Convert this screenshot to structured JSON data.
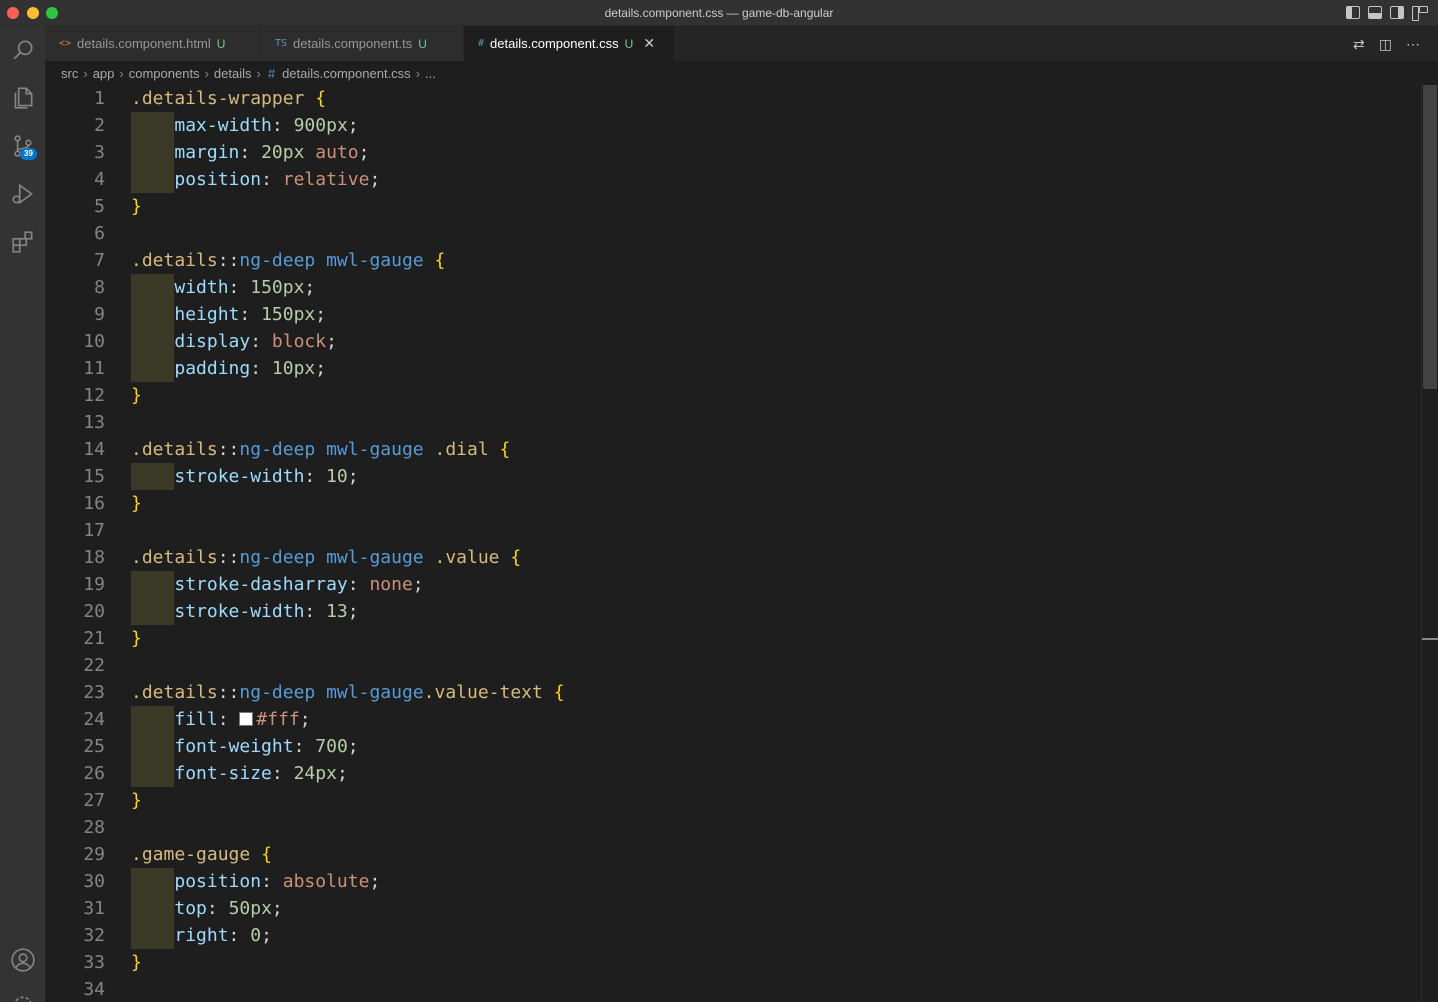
{
  "window": {
    "title": "details.component.css — game-db-angular"
  },
  "activity_bar": {
    "items": [
      {
        "name": "explorer-search",
        "icon": "search-icon"
      },
      {
        "name": "explorer",
        "icon": "files-icon"
      },
      {
        "name": "source-control",
        "icon": "source-control-icon",
        "badge": "39"
      },
      {
        "name": "run-debug",
        "icon": "run-debug-icon"
      },
      {
        "name": "extensions",
        "icon": "extensions-icon"
      }
    ],
    "bottom": [
      {
        "name": "accounts",
        "icon": "account-icon"
      },
      {
        "name": "manage",
        "icon": "gear-icon"
      }
    ]
  },
  "tabs": [
    {
      "label": "details.component.html",
      "icon_text": "<>",
      "icon_color": "#e37933",
      "modified": "U",
      "active": false
    },
    {
      "label": "details.component.ts",
      "icon_text": "TS",
      "icon_color": "#519aba",
      "modified": "U",
      "active": false
    },
    {
      "label": "details.component.css",
      "icon_text": "#",
      "icon_color": "#519aba",
      "modified": "U",
      "active": true
    }
  ],
  "breadcrumb": {
    "parts": [
      "src",
      "app",
      "components",
      "details"
    ],
    "file": "details.component.css",
    "trail": "..."
  },
  "colors": {
    "selector": "#d7ba7d",
    "element": "#569cd6",
    "property": "#9cdcfe",
    "number": "#b5cea8",
    "keyword": "#ce9178",
    "brace": "#ffd700"
  },
  "code_lines": [
    {
      "n": "1",
      "tokens": [
        [
          "sel",
          ".details-wrapper"
        ],
        [
          "t",
          " "
        ],
        [
          "brace",
          "{"
        ]
      ]
    },
    {
      "n": "2",
      "indent": true,
      "tokens": [
        [
          "t",
          "    "
        ],
        [
          "prop",
          "max-width"
        ],
        [
          "t",
          ": "
        ],
        [
          "num",
          "900px"
        ],
        [
          "t",
          ";"
        ]
      ]
    },
    {
      "n": "3",
      "indent": true,
      "tokens": [
        [
          "t",
          "    "
        ],
        [
          "prop",
          "margin"
        ],
        [
          "t",
          ": "
        ],
        [
          "num",
          "20px"
        ],
        [
          "t",
          " "
        ],
        [
          "kw",
          "auto"
        ],
        [
          "t",
          ";"
        ]
      ]
    },
    {
      "n": "4",
      "indent": true,
      "tokens": [
        [
          "t",
          "    "
        ],
        [
          "prop",
          "position"
        ],
        [
          "t",
          ": "
        ],
        [
          "kw",
          "relative"
        ],
        [
          "t",
          ";"
        ]
      ]
    },
    {
      "n": "5",
      "tokens": [
        [
          "brace",
          "}"
        ]
      ]
    },
    {
      "n": "6",
      "tokens": []
    },
    {
      "n": "7",
      "tokens": [
        [
          "sel",
          ".details"
        ],
        [
          "t",
          "::"
        ],
        [
          "el",
          "ng-deep"
        ],
        [
          "t",
          " "
        ],
        [
          "el",
          "mwl-gauge"
        ],
        [
          "t",
          " "
        ],
        [
          "brace",
          "{"
        ]
      ]
    },
    {
      "n": "8",
      "indent": true,
      "tokens": [
        [
          "t",
          "    "
        ],
        [
          "prop",
          "width"
        ],
        [
          "t",
          ": "
        ],
        [
          "num",
          "150px"
        ],
        [
          "t",
          ";"
        ]
      ]
    },
    {
      "n": "9",
      "indent": true,
      "tokens": [
        [
          "t",
          "    "
        ],
        [
          "prop",
          "height"
        ],
        [
          "t",
          ": "
        ],
        [
          "num",
          "150px"
        ],
        [
          "t",
          ";"
        ]
      ]
    },
    {
      "n": "10",
      "indent": true,
      "tokens": [
        [
          "t",
          "    "
        ],
        [
          "prop",
          "display"
        ],
        [
          "t",
          ": "
        ],
        [
          "kw",
          "block"
        ],
        [
          "t",
          ";"
        ]
      ]
    },
    {
      "n": "11",
      "indent": true,
      "tokens": [
        [
          "t",
          "    "
        ],
        [
          "prop",
          "padding"
        ],
        [
          "t",
          ": "
        ],
        [
          "num",
          "10px"
        ],
        [
          "t",
          ";"
        ]
      ]
    },
    {
      "n": "12",
      "tokens": [
        [
          "brace",
          "}"
        ]
      ]
    },
    {
      "n": "13",
      "tokens": []
    },
    {
      "n": "14",
      "tokens": [
        [
          "sel",
          ".details"
        ],
        [
          "t",
          "::"
        ],
        [
          "el",
          "ng-deep"
        ],
        [
          "t",
          " "
        ],
        [
          "el",
          "mwl-gauge"
        ],
        [
          "t",
          " "
        ],
        [
          "sel",
          ".dial"
        ],
        [
          "t",
          " "
        ],
        [
          "brace",
          "{"
        ]
      ]
    },
    {
      "n": "15",
      "indent": true,
      "tokens": [
        [
          "t",
          "    "
        ],
        [
          "prop",
          "stroke-width"
        ],
        [
          "t",
          ": "
        ],
        [
          "num",
          "10"
        ],
        [
          "t",
          ";"
        ]
      ]
    },
    {
      "n": "16",
      "tokens": [
        [
          "brace",
          "}"
        ]
      ]
    },
    {
      "n": "17",
      "tokens": []
    },
    {
      "n": "18",
      "tokens": [
        [
          "sel",
          ".details"
        ],
        [
          "t",
          "::"
        ],
        [
          "el",
          "ng-deep"
        ],
        [
          "t",
          " "
        ],
        [
          "el",
          "mwl-gauge"
        ],
        [
          "t",
          " "
        ],
        [
          "sel",
          ".value"
        ],
        [
          "t",
          " "
        ],
        [
          "brace",
          "{"
        ]
      ]
    },
    {
      "n": "19",
      "indent": true,
      "tokens": [
        [
          "t",
          "    "
        ],
        [
          "prop",
          "stroke-dasharray"
        ],
        [
          "t",
          ": "
        ],
        [
          "kw",
          "none"
        ],
        [
          "t",
          ";"
        ]
      ]
    },
    {
      "n": "20",
      "indent": true,
      "tokens": [
        [
          "t",
          "    "
        ],
        [
          "prop",
          "stroke-width"
        ],
        [
          "t",
          ": "
        ],
        [
          "num",
          "13"
        ],
        [
          "t",
          ";"
        ]
      ]
    },
    {
      "n": "21",
      "tokens": [
        [
          "brace",
          "}"
        ]
      ]
    },
    {
      "n": "22",
      "tokens": []
    },
    {
      "n": "23",
      "tokens": [
        [
          "sel",
          ".details"
        ],
        [
          "t",
          "::"
        ],
        [
          "el",
          "ng-deep"
        ],
        [
          "t",
          " "
        ],
        [
          "el",
          "mwl-gauge"
        ],
        [
          "sel",
          ".value-text"
        ],
        [
          "t",
          " "
        ],
        [
          "brace",
          "{"
        ]
      ]
    },
    {
      "n": "24",
      "indent": true,
      "swatch": true,
      "tokens": [
        [
          "t",
          "    "
        ],
        [
          "prop",
          "fill"
        ],
        [
          "t",
          ": "
        ],
        [
          "swatch",
          ""
        ],
        [
          "kw",
          "#fff"
        ],
        [
          "t",
          ";"
        ]
      ]
    },
    {
      "n": "25",
      "indent": true,
      "tokens": [
        [
          "t",
          "    "
        ],
        [
          "prop",
          "font-weight"
        ],
        [
          "t",
          ": "
        ],
        [
          "num",
          "700"
        ],
        [
          "t",
          ";"
        ]
      ]
    },
    {
      "n": "26",
      "indent": true,
      "tokens": [
        [
          "t",
          "    "
        ],
        [
          "prop",
          "font-size"
        ],
        [
          "t",
          ": "
        ],
        [
          "num",
          "24px"
        ],
        [
          "t",
          ";"
        ]
      ]
    },
    {
      "n": "27",
      "tokens": [
        [
          "brace",
          "}"
        ]
      ]
    },
    {
      "n": "28",
      "tokens": []
    },
    {
      "n": "29",
      "tokens": [
        [
          "sel",
          ".game-gauge"
        ],
        [
          "t",
          " "
        ],
        [
          "brace",
          "{"
        ]
      ]
    },
    {
      "n": "30",
      "indent": true,
      "tokens": [
        [
          "t",
          "    "
        ],
        [
          "prop",
          "position"
        ],
        [
          "t",
          ": "
        ],
        [
          "kw",
          "absolute"
        ],
        [
          "t",
          ";"
        ]
      ]
    },
    {
      "n": "31",
      "indent": true,
      "tokens": [
        [
          "t",
          "    "
        ],
        [
          "prop",
          "top"
        ],
        [
          "t",
          ": "
        ],
        [
          "num",
          "50px"
        ],
        [
          "t",
          ";"
        ]
      ]
    },
    {
      "n": "32",
      "indent": true,
      "tokens": [
        [
          "t",
          "    "
        ],
        [
          "prop",
          "right"
        ],
        [
          "t",
          ": "
        ],
        [
          "num",
          "0"
        ],
        [
          "t",
          ";"
        ]
      ]
    },
    {
      "n": "33",
      "tokens": [
        [
          "brace",
          "}"
        ]
      ]
    },
    {
      "n": "34",
      "tokens": []
    }
  ]
}
